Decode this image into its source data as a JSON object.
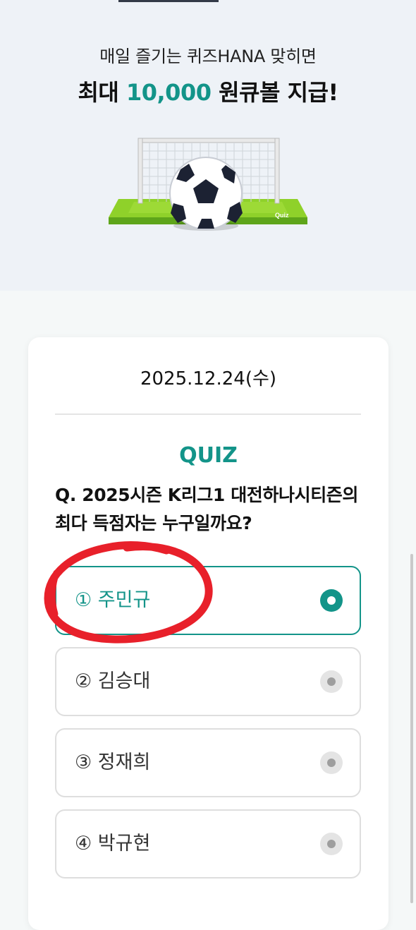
{
  "hero": {
    "subtitle": "매일 즐기는 퀴즈HANA 맞히면",
    "title_before": "최대 ",
    "title_accent": "10,000",
    "title_after": " 원큐볼 지급!",
    "illustration_icon": "soccer-goal-ball-icon",
    "illustration_badge": "Quiz"
  },
  "quiz": {
    "date": "2025.12.24(수)",
    "label": "QUIZ",
    "question": "Q. 2025시즌 K리그1 대전하나시티즌의 최다 득점자는 누구일까요?",
    "options": [
      {
        "label": "① 주민규",
        "selected": true
      },
      {
        "label": "② 김승대",
        "selected": false
      },
      {
        "label": "③ 정재희",
        "selected": false
      },
      {
        "label": "④ 박규현",
        "selected": false
      }
    ]
  },
  "colors": {
    "accent": "#139489",
    "hero_bg": "#eef2f7",
    "annotation": "#e8202a"
  }
}
